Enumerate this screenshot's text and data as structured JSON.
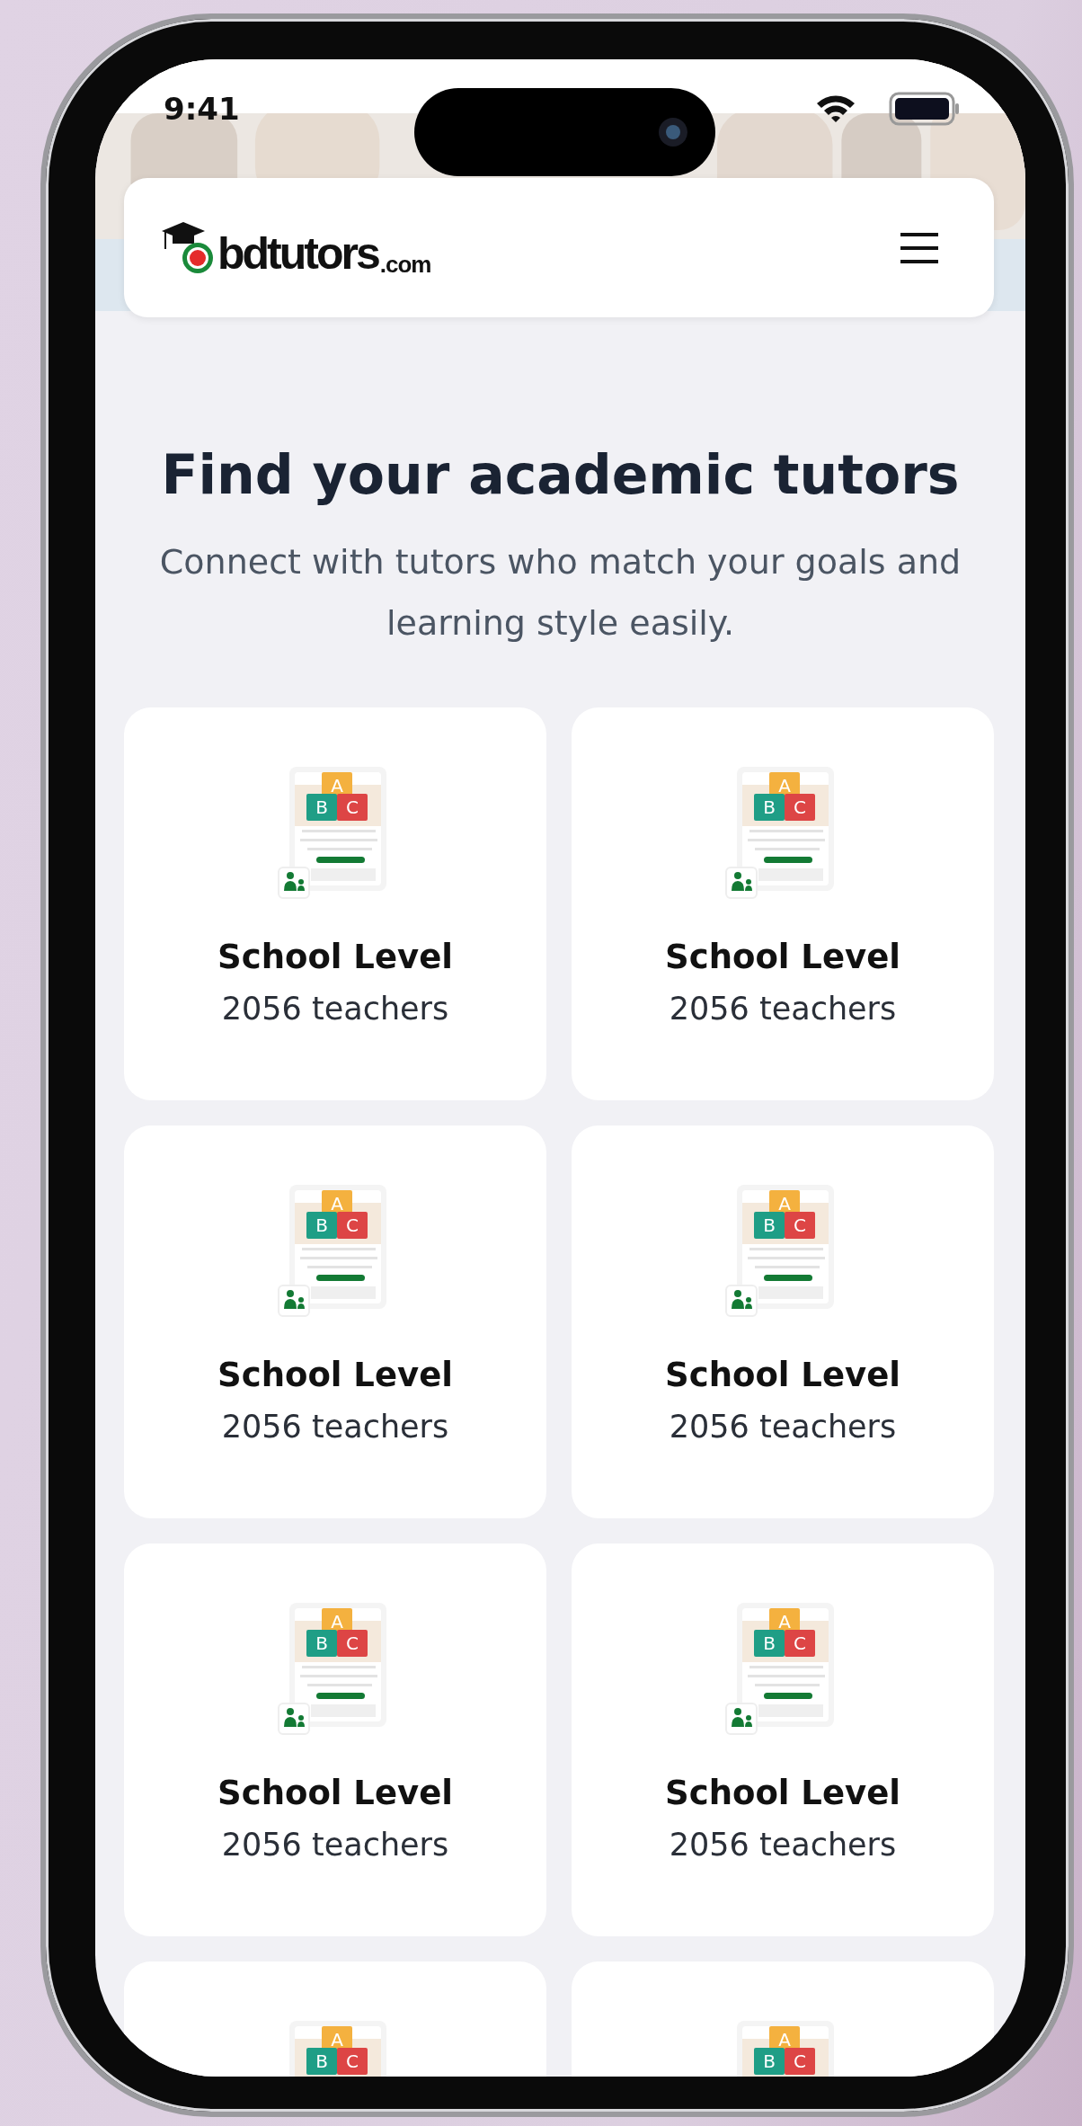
{
  "status_bar": {
    "time": "9:41"
  },
  "header": {
    "logo": {
      "name": "bdtutors",
      "suffix": ".com"
    }
  },
  "hero": {
    "title": "Find your academic tutors",
    "subtitle": "Connect with tutors who match your goals and learning style easily."
  },
  "categories": [
    {
      "blocks": [
        "A",
        "B",
        "C"
      ],
      "title": "School Level",
      "count": "2056 teachers"
    },
    {
      "blocks": [
        "A",
        "B",
        "C"
      ],
      "title": "School Level",
      "count": "2056 teachers"
    },
    {
      "blocks": [
        "A",
        "B",
        "C"
      ],
      "title": "School Level",
      "count": "2056 teachers"
    },
    {
      "blocks": [
        "A",
        "B",
        "C"
      ],
      "title": "School Level",
      "count": "2056 teachers"
    },
    {
      "blocks": [
        "A",
        "B",
        "C"
      ],
      "title": "School Level",
      "count": "2056 teachers"
    },
    {
      "blocks": [
        "A",
        "B",
        "C"
      ],
      "title": "School Level",
      "count": "2056 teachers"
    },
    {
      "blocks": [
        "A",
        "B",
        "C"
      ]
    },
    {
      "blocks": [
        "A",
        "B",
        "C"
      ]
    }
  ]
}
